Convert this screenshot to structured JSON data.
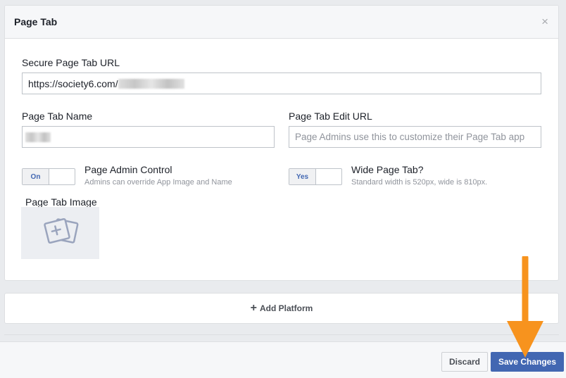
{
  "dialog": {
    "title": "Page Tab",
    "close_glyph": "×"
  },
  "fields": {
    "secure_url": {
      "label": "Secure Page Tab URL",
      "value": "https://society6.com/"
    },
    "tab_name": {
      "label": "Page Tab Name",
      "value": ""
    },
    "edit_url": {
      "label": "Page Tab Edit URL",
      "placeholder": "Page Admins use this to customize their Page Tab app"
    }
  },
  "toggles": {
    "admin_control": {
      "state": "On",
      "title": "Page Admin Control",
      "description": "Admins can override App Image and Name"
    },
    "wide_tab": {
      "state": "Yes",
      "title": "Wide Page Tab?",
      "description": "Standard width is 520px, wide is 810px."
    }
  },
  "image": {
    "label": "Page Tab Image",
    "icon": "add-photo-icon"
  },
  "add_platform": {
    "label": "Add Platform",
    "icon": "plus-icon"
  },
  "footer": {
    "discard_label": "Discard",
    "save_label": "Save Changes"
  },
  "colors": {
    "primary": "#4267b2",
    "annotation_arrow": "#f7931e"
  }
}
